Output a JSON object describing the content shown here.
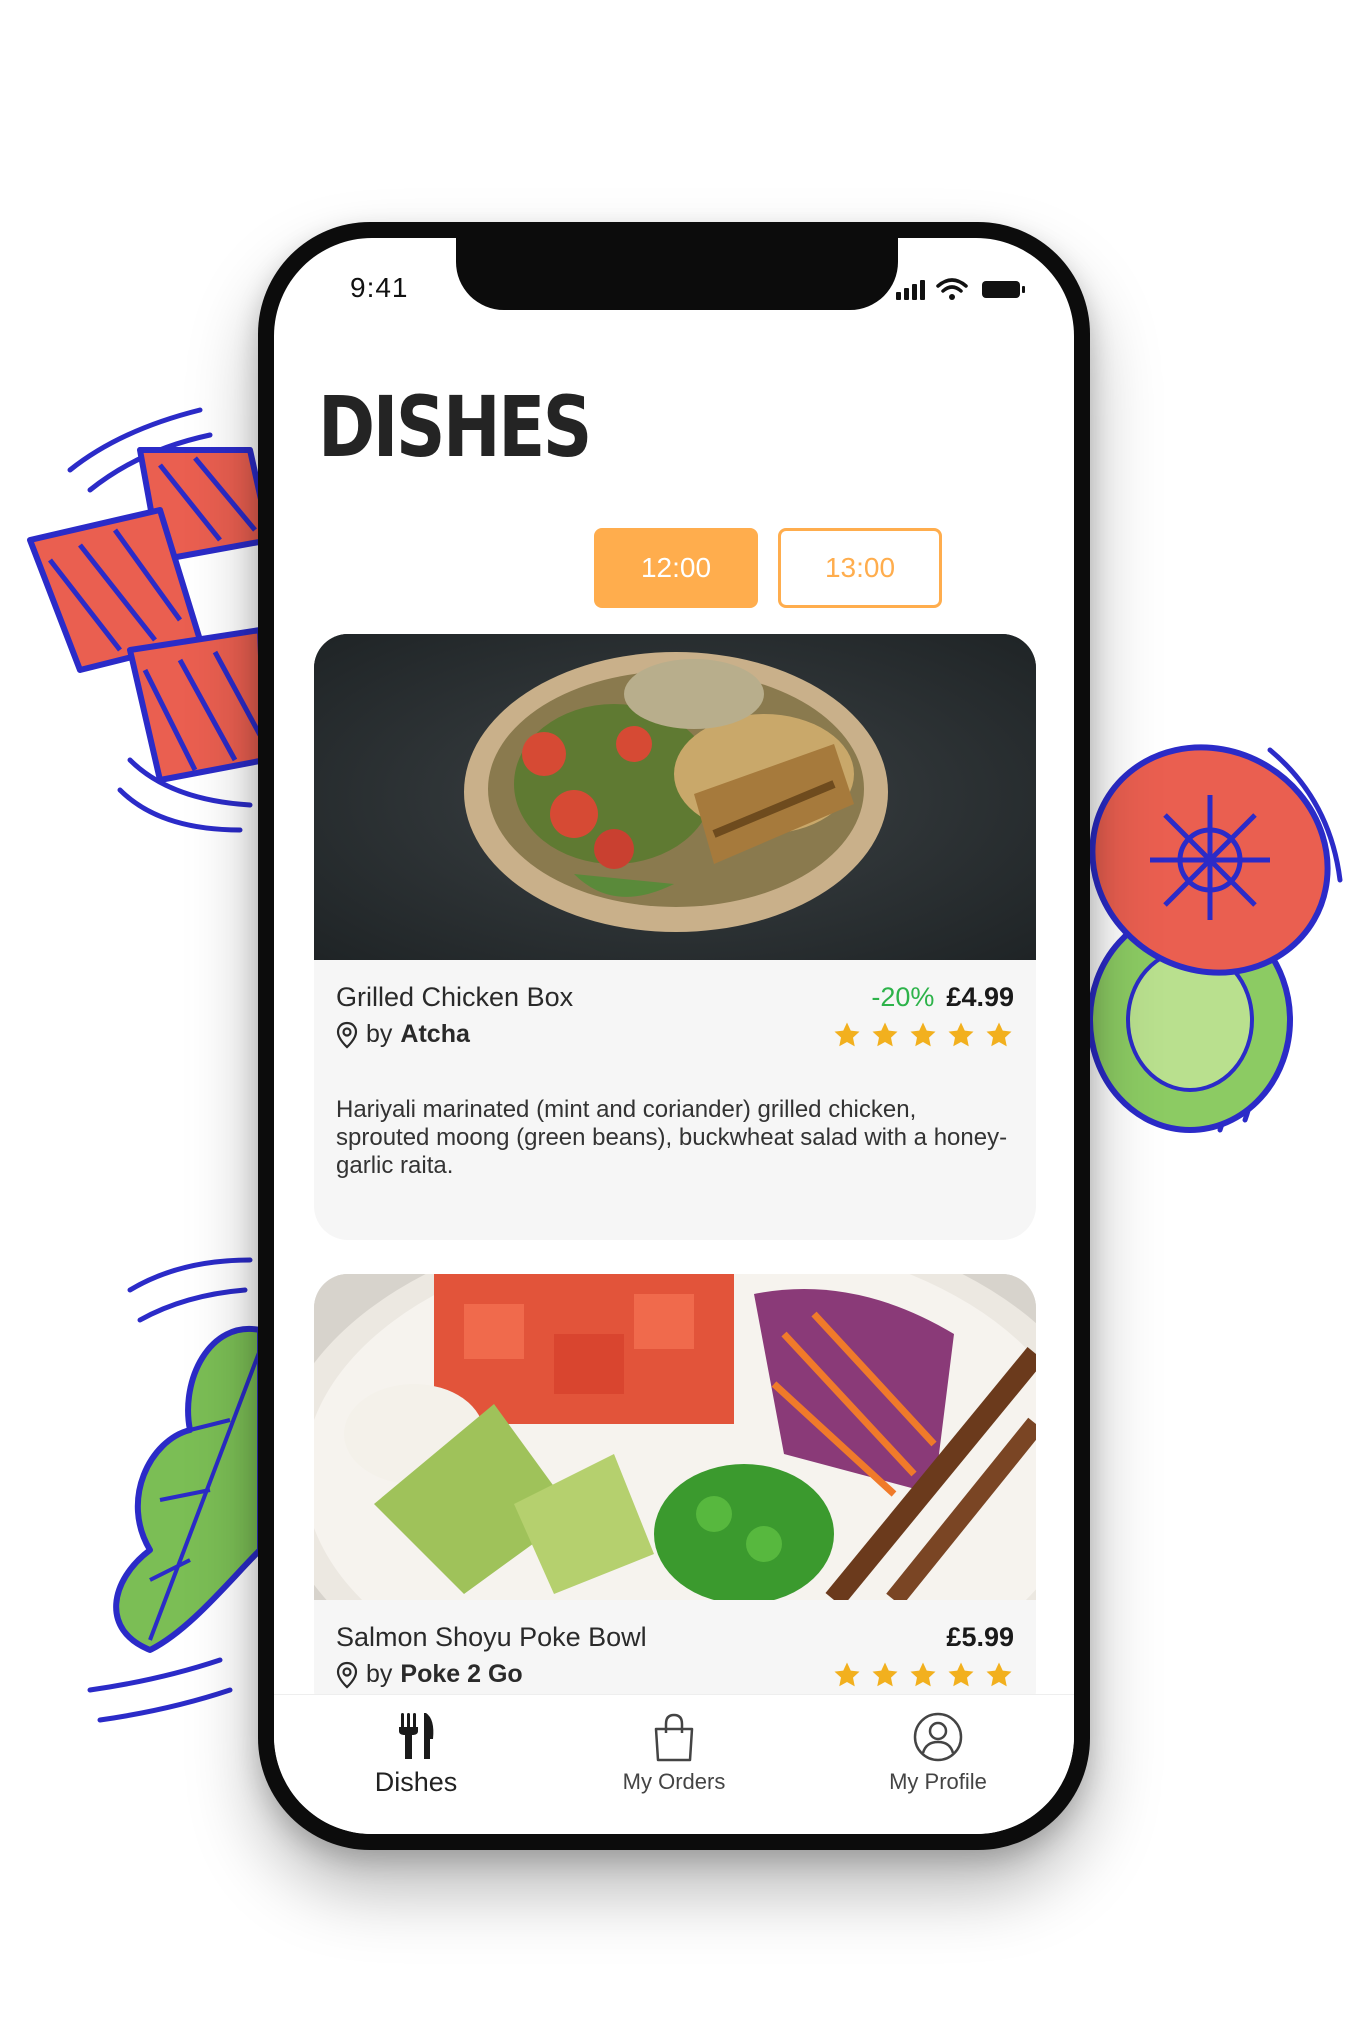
{
  "status_bar": {
    "time": "9:41"
  },
  "page": {
    "title": "DISHES"
  },
  "time_slots": [
    {
      "label": "12:00",
      "selected": true
    },
    {
      "label": "13:00",
      "selected": false
    }
  ],
  "dishes": [
    {
      "name": "Grilled Chicken Box",
      "by_prefix": "by",
      "vendor": "Atcha",
      "discount": "-20%",
      "price": "£4.99",
      "rating": 5,
      "description": "Hariyali marinated (mint and coriander) grilled chicken, sprouted moong (green beans), buckwheat salad with a honey-garlic raita."
    },
    {
      "name": "Salmon Shoyu Poke Bowl",
      "by_prefix": "by",
      "vendor": "Poke 2 Go",
      "price": "£5.99",
      "rating": 5
    }
  ],
  "tab_bar": {
    "tabs": [
      {
        "label": "Dishes",
        "icon": "cutlery-icon",
        "active": true
      },
      {
        "label": "My Orders",
        "icon": "shopping-bag-icon",
        "active": false
      },
      {
        "label": "My Profile",
        "icon": "profile-icon",
        "active": false
      }
    ]
  },
  "colors": {
    "accent": "#FFAD4D",
    "discount": "#2DB34A",
    "star": "#F2B01E",
    "title": "#242424"
  }
}
